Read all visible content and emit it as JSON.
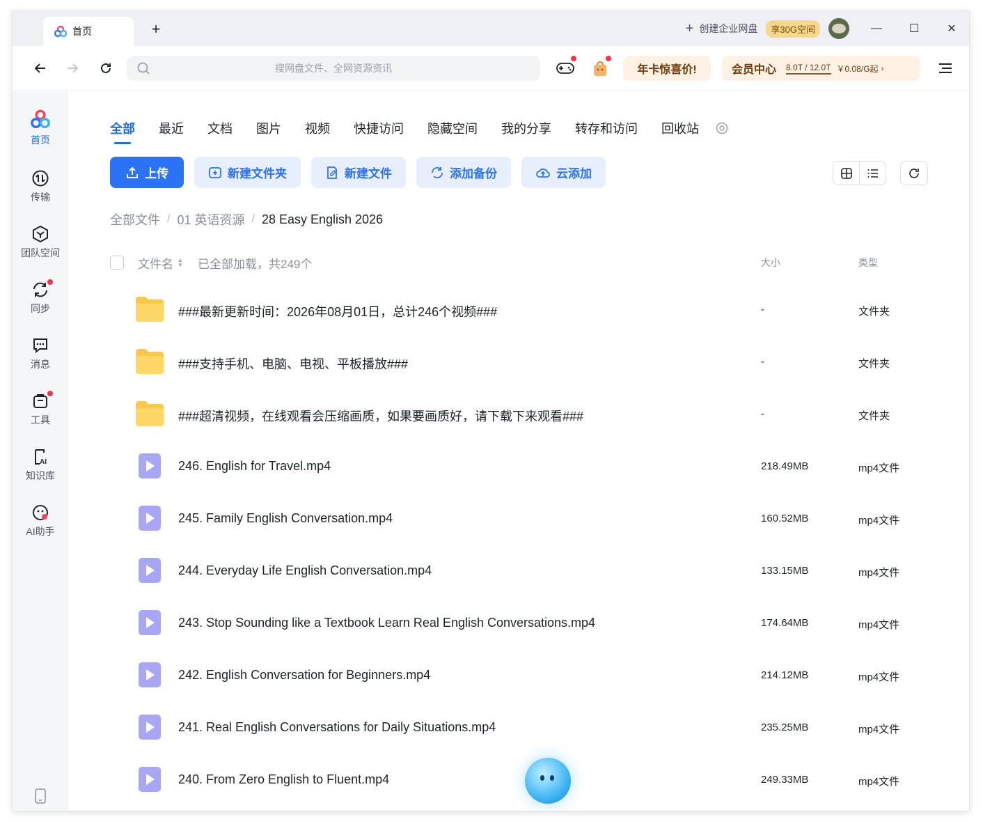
{
  "titlebar": {
    "tab_title": "首页",
    "new_tab": "+",
    "enterprise": "创建企业网盘",
    "space_badge": "享30G空间",
    "minimize": "—",
    "maximize": "☐",
    "close": "✕"
  },
  "nav": {
    "search_placeholder": "搜网盘文件、全网资源资讯",
    "promo": "年卡惊喜价!",
    "vip_title": "会员中心",
    "quota": "8.0T / 12.0T",
    "price": "￥0.08/G起",
    "arrow": "›"
  },
  "sidebar": {
    "items": [
      {
        "label": "首页",
        "icon": "home-logo-icon"
      },
      {
        "label": "传输",
        "icon": "transfer-icon"
      },
      {
        "label": "团队空间",
        "icon": "team-space-icon"
      },
      {
        "label": "同步",
        "icon": "sync-icon"
      },
      {
        "label": "消息",
        "icon": "message-icon"
      },
      {
        "label": "工具",
        "icon": "tools-icon"
      },
      {
        "label": "知识库",
        "icon": "knowledge-base-icon"
      },
      {
        "label": "AI助手",
        "icon": "ai-assistant-icon"
      }
    ]
  },
  "categories": [
    "全部",
    "最近",
    "文档",
    "图片",
    "视频",
    "快捷访问",
    "隐藏空间",
    "我的分享",
    "转存和访问",
    "回收站"
  ],
  "actions": {
    "upload": "上传",
    "new_folder": "新建文件夹",
    "new_file": "新建文件",
    "add_backup": "添加备份",
    "cloud_add": "云添加"
  },
  "breadcrumb": {
    "root": "全部文件",
    "level1": "01 英语资源",
    "current": "28 Easy English 2026",
    "sep": "/"
  },
  "list": {
    "col_name": "文件名",
    "loaded": "已全部加载，共249个",
    "col_size": "大小",
    "col_type": "类型",
    "rows": [
      {
        "name": "###最新更新时间：2026年08月01日，总计246个视频###",
        "size": "-",
        "type": "文件夹",
        "kind": "folder"
      },
      {
        "name": "###支持手机、电脑、电视、平板播放###",
        "size": "-",
        "type": "文件夹",
        "kind": "folder"
      },
      {
        "name": "###超清视频，在线观看会压缩画质，如果要画质好，请下载下来观看###",
        "size": "-",
        "type": "文件夹",
        "kind": "folder"
      },
      {
        "name": "246. English for Travel.mp4",
        "size": "218.49MB",
        "type": "mp4文件",
        "kind": "video"
      },
      {
        "name": "245. Family English Conversation.mp4",
        "size": "160.52MB",
        "type": "mp4文件",
        "kind": "video"
      },
      {
        "name": "244. Everyday Life English Conversation.mp4",
        "size": "133.15MB",
        "type": "mp4文件",
        "kind": "video"
      },
      {
        "name": "243. Stop Sounding like a Textbook Learn Real English Conversations.mp4",
        "size": "174.64MB",
        "type": "mp4文件",
        "kind": "video"
      },
      {
        "name": "242. English Conversation for Beginners.mp4",
        "size": "214.12MB",
        "type": "mp4文件",
        "kind": "video"
      },
      {
        "name": "241. Real English Conversations for Daily Situations.mp4",
        "size": "235.25MB",
        "type": "mp4文件",
        "kind": "video"
      },
      {
        "name": "240. From Zero English to Fluent.mp4",
        "size": "249.33MB",
        "type": "mp4文件",
        "kind": "video"
      }
    ]
  },
  "colors": {
    "accent": "#2a73f5",
    "folder": "#fbc84a",
    "video": "#a9a6f5",
    "promo_bg": "#fdf2e3"
  }
}
